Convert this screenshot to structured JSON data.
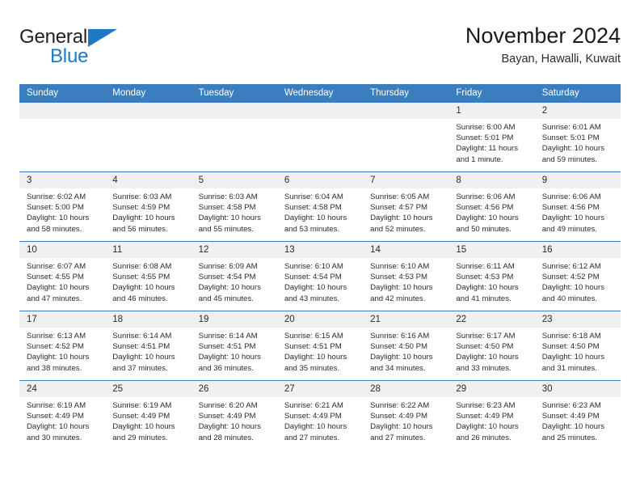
{
  "logo": {
    "word1": "General",
    "word2": "Blue",
    "triangle_color": "#1f79c4",
    "icon": "general-blue-logo"
  },
  "header": {
    "title": "November 2024",
    "subtitle": "Bayan, Hawalli, Kuwait"
  },
  "theme": {
    "header_bg": "#3a7ebf",
    "daynum_bg": "#f0f0f0",
    "text": "#2b2b2b"
  },
  "weekdays": [
    "Sunday",
    "Monday",
    "Tuesday",
    "Wednesday",
    "Thursday",
    "Friday",
    "Saturday"
  ],
  "weeks": [
    [
      {
        "day": "",
        "sunrise": "",
        "sunset": "",
        "daylight1": "",
        "daylight2": "",
        "empty": true
      },
      {
        "day": "",
        "sunrise": "",
        "sunset": "",
        "daylight1": "",
        "daylight2": "",
        "empty": true
      },
      {
        "day": "",
        "sunrise": "",
        "sunset": "",
        "daylight1": "",
        "daylight2": "",
        "empty": true
      },
      {
        "day": "",
        "sunrise": "",
        "sunset": "",
        "daylight1": "",
        "daylight2": "",
        "empty": true
      },
      {
        "day": "",
        "sunrise": "",
        "sunset": "",
        "daylight1": "",
        "daylight2": "",
        "empty": true
      },
      {
        "day": "1",
        "sunrise": "Sunrise: 6:00 AM",
        "sunset": "Sunset: 5:01 PM",
        "daylight1": "Daylight: 11 hours",
        "daylight2": "and 1 minute.",
        "empty": false
      },
      {
        "day": "2",
        "sunrise": "Sunrise: 6:01 AM",
        "sunset": "Sunset: 5:01 PM",
        "daylight1": "Daylight: 10 hours",
        "daylight2": "and 59 minutes.",
        "empty": false
      }
    ],
    [
      {
        "day": "3",
        "sunrise": "Sunrise: 6:02 AM",
        "sunset": "Sunset: 5:00 PM",
        "daylight1": "Daylight: 10 hours",
        "daylight2": "and 58 minutes.",
        "empty": false
      },
      {
        "day": "4",
        "sunrise": "Sunrise: 6:03 AM",
        "sunset": "Sunset: 4:59 PM",
        "daylight1": "Daylight: 10 hours",
        "daylight2": "and 56 minutes.",
        "empty": false
      },
      {
        "day": "5",
        "sunrise": "Sunrise: 6:03 AM",
        "sunset": "Sunset: 4:58 PM",
        "daylight1": "Daylight: 10 hours",
        "daylight2": "and 55 minutes.",
        "empty": false
      },
      {
        "day": "6",
        "sunrise": "Sunrise: 6:04 AM",
        "sunset": "Sunset: 4:58 PM",
        "daylight1": "Daylight: 10 hours",
        "daylight2": "and 53 minutes.",
        "empty": false
      },
      {
        "day": "7",
        "sunrise": "Sunrise: 6:05 AM",
        "sunset": "Sunset: 4:57 PM",
        "daylight1": "Daylight: 10 hours",
        "daylight2": "and 52 minutes.",
        "empty": false
      },
      {
        "day": "8",
        "sunrise": "Sunrise: 6:06 AM",
        "sunset": "Sunset: 4:56 PM",
        "daylight1": "Daylight: 10 hours",
        "daylight2": "and 50 minutes.",
        "empty": false
      },
      {
        "day": "9",
        "sunrise": "Sunrise: 6:06 AM",
        "sunset": "Sunset: 4:56 PM",
        "daylight1": "Daylight: 10 hours",
        "daylight2": "and 49 minutes.",
        "empty": false
      }
    ],
    [
      {
        "day": "10",
        "sunrise": "Sunrise: 6:07 AM",
        "sunset": "Sunset: 4:55 PM",
        "daylight1": "Daylight: 10 hours",
        "daylight2": "and 47 minutes.",
        "empty": false
      },
      {
        "day": "11",
        "sunrise": "Sunrise: 6:08 AM",
        "sunset": "Sunset: 4:55 PM",
        "daylight1": "Daylight: 10 hours",
        "daylight2": "and 46 minutes.",
        "empty": false
      },
      {
        "day": "12",
        "sunrise": "Sunrise: 6:09 AM",
        "sunset": "Sunset: 4:54 PM",
        "daylight1": "Daylight: 10 hours",
        "daylight2": "and 45 minutes.",
        "empty": false
      },
      {
        "day": "13",
        "sunrise": "Sunrise: 6:10 AM",
        "sunset": "Sunset: 4:54 PM",
        "daylight1": "Daylight: 10 hours",
        "daylight2": "and 43 minutes.",
        "empty": false
      },
      {
        "day": "14",
        "sunrise": "Sunrise: 6:10 AM",
        "sunset": "Sunset: 4:53 PM",
        "daylight1": "Daylight: 10 hours",
        "daylight2": "and 42 minutes.",
        "empty": false
      },
      {
        "day": "15",
        "sunrise": "Sunrise: 6:11 AM",
        "sunset": "Sunset: 4:53 PM",
        "daylight1": "Daylight: 10 hours",
        "daylight2": "and 41 minutes.",
        "empty": false
      },
      {
        "day": "16",
        "sunrise": "Sunrise: 6:12 AM",
        "sunset": "Sunset: 4:52 PM",
        "daylight1": "Daylight: 10 hours",
        "daylight2": "and 40 minutes.",
        "empty": false
      }
    ],
    [
      {
        "day": "17",
        "sunrise": "Sunrise: 6:13 AM",
        "sunset": "Sunset: 4:52 PM",
        "daylight1": "Daylight: 10 hours",
        "daylight2": "and 38 minutes.",
        "empty": false
      },
      {
        "day": "18",
        "sunrise": "Sunrise: 6:14 AM",
        "sunset": "Sunset: 4:51 PM",
        "daylight1": "Daylight: 10 hours",
        "daylight2": "and 37 minutes.",
        "empty": false
      },
      {
        "day": "19",
        "sunrise": "Sunrise: 6:14 AM",
        "sunset": "Sunset: 4:51 PM",
        "daylight1": "Daylight: 10 hours",
        "daylight2": "and 36 minutes.",
        "empty": false
      },
      {
        "day": "20",
        "sunrise": "Sunrise: 6:15 AM",
        "sunset": "Sunset: 4:51 PM",
        "daylight1": "Daylight: 10 hours",
        "daylight2": "and 35 minutes.",
        "empty": false
      },
      {
        "day": "21",
        "sunrise": "Sunrise: 6:16 AM",
        "sunset": "Sunset: 4:50 PM",
        "daylight1": "Daylight: 10 hours",
        "daylight2": "and 34 minutes.",
        "empty": false
      },
      {
        "day": "22",
        "sunrise": "Sunrise: 6:17 AM",
        "sunset": "Sunset: 4:50 PM",
        "daylight1": "Daylight: 10 hours",
        "daylight2": "and 33 minutes.",
        "empty": false
      },
      {
        "day": "23",
        "sunrise": "Sunrise: 6:18 AM",
        "sunset": "Sunset: 4:50 PM",
        "daylight1": "Daylight: 10 hours",
        "daylight2": "and 31 minutes.",
        "empty": false
      }
    ],
    [
      {
        "day": "24",
        "sunrise": "Sunrise: 6:19 AM",
        "sunset": "Sunset: 4:49 PM",
        "daylight1": "Daylight: 10 hours",
        "daylight2": "and 30 minutes.",
        "empty": false
      },
      {
        "day": "25",
        "sunrise": "Sunrise: 6:19 AM",
        "sunset": "Sunset: 4:49 PM",
        "daylight1": "Daylight: 10 hours",
        "daylight2": "and 29 minutes.",
        "empty": false
      },
      {
        "day": "26",
        "sunrise": "Sunrise: 6:20 AM",
        "sunset": "Sunset: 4:49 PM",
        "daylight1": "Daylight: 10 hours",
        "daylight2": "and 28 minutes.",
        "empty": false
      },
      {
        "day": "27",
        "sunrise": "Sunrise: 6:21 AM",
        "sunset": "Sunset: 4:49 PM",
        "daylight1": "Daylight: 10 hours",
        "daylight2": "and 27 minutes.",
        "empty": false
      },
      {
        "day": "28",
        "sunrise": "Sunrise: 6:22 AM",
        "sunset": "Sunset: 4:49 PM",
        "daylight1": "Daylight: 10 hours",
        "daylight2": "and 27 minutes.",
        "empty": false
      },
      {
        "day": "29",
        "sunrise": "Sunrise: 6:23 AM",
        "sunset": "Sunset: 4:49 PM",
        "daylight1": "Daylight: 10 hours",
        "daylight2": "and 26 minutes.",
        "empty": false
      },
      {
        "day": "30",
        "sunrise": "Sunrise: 6:23 AM",
        "sunset": "Sunset: 4:49 PM",
        "daylight1": "Daylight: 10 hours",
        "daylight2": "and 25 minutes.",
        "empty": false
      }
    ]
  ]
}
